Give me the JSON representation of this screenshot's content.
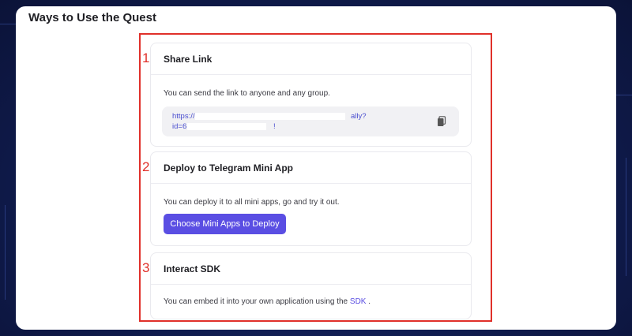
{
  "panel": {
    "title": "Ways to Use the Quest"
  },
  "sections": [
    {
      "number": "1",
      "title": "Share Link",
      "description": "You can send the link to anyone and any group.",
      "link_line1_start": "https://d",
      "link_line1_end": "ally?",
      "link_line2_start": "id=6",
      "link_line2_end": "!"
    },
    {
      "number": "2",
      "title": "Deploy to Telegram Mini App",
      "description": "You can deploy it to all mini apps, go and try it out.",
      "button_label": "Choose Mini Apps to Deploy"
    },
    {
      "number": "3",
      "title": "Interact SDK",
      "description_prefix": "You can embed it into your own application using the",
      "link_label": "SDK",
      "description_suffix": "."
    }
  ],
  "colors": {
    "accent": "#5a4ee3",
    "highlight_border": "#e0302a",
    "link": "#4b4fd0"
  },
  "icons": {
    "copy": "copy-icon"
  }
}
